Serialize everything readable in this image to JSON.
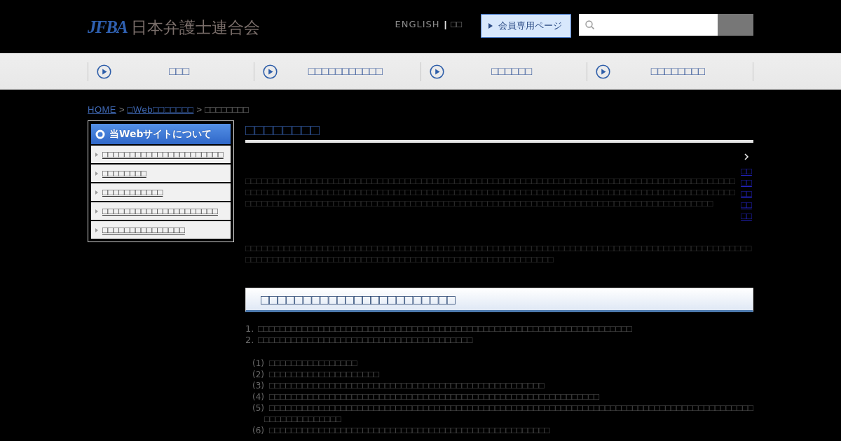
{
  "header": {
    "logo_mark": "JFBA",
    "logo_text": "日本弁護士連合会",
    "language_links": [
      {
        "label": "ENGLISH"
      },
      {
        "label": "□□"
      }
    ],
    "separator": "|",
    "member_button": {
      "label": "会員専用ページ"
    }
  },
  "nav": [
    {
      "label": "□□□"
    },
    {
      "label": "□□□□□□□□□□□"
    },
    {
      "label": "□□□□□□"
    },
    {
      "label": "□□□□□□□□"
    }
  ],
  "breadcrumb": [
    {
      "label": "HOME",
      "kind": "link"
    },
    {
      "label": "□Web□□□□□□□",
      "kind": "link",
      "separator": ">"
    },
    {
      "label": "□□□□□□□□",
      "kind": "current",
      "separator": ">"
    }
  ],
  "sidebar": {
    "title": "当Webサイトについて",
    "items": [
      {
        "label": "□□□□□□□□□□□□□□□□□□□□□□"
      },
      {
        "label": "□□□□□□□□"
      },
      {
        "label": "□□□□□□□□□□□"
      },
      {
        "label": "□□□□□□□□□□□□□□□□□□□□□"
      },
      {
        "label": "□□□□□□□□□□□□□□□"
      }
    ]
  },
  "content": {
    "title": "□□□□□□□□",
    "print_link": "□□□□□□□□□□",
    "paragraphs": [
      "□□□□□□□□□□□□□□□□□□□□□□□□□□□□□□□□□□□□□□□□□□□□□□□□□□□□□□□□□□□□□□□□□□□□□□□□□□□□□□□□□□□□□□□□□□□□□□□□□□□□□□□□□□□□□□□□□□□□□□□□□□□□□□□□□□□□□□□□□□□□□□□□□□□□□□□□□□□□□□□□□□□□□□□□□□□□□□□□□□□□□□□□□□□□□□□□□□□□□□□□□□□□□□□□□□□□□□□□□□□□□□□□□□□□□□□□□□□□□□□□□□□□□□□□□□□□□□□□□□□□□□□",
      "□□□□□□□□□□□□□□□□□□□□□□□□□□□□□□□□□□□□□□□□□□□□□□□□□□□□□□□□□□□□□□□□□□□□□□□□□□□□□□□□□□□□□□□□□□□□□□□□□□□□□□□□□□□□□□□□□□□□□□□□□□□□□□□□□□□□□□□□□□□□□□□□□□□□"
    ],
    "section": {
      "title": "□□□□□□□□□□□□□□□□□□□□□□□",
      "items": [
        {
          "marker": "1.",
          "text": "□□□□□□□□□□□□□□□□□□□□□□□□□□□□□□□□□□□□□□□□□□□□□□□□□□□□□□□□□□□□□□□□□□□□"
        },
        {
          "marker": "2.",
          "text": "□□□□□□□□□□□□□□□□□□□□□□□□□□□□□□□□□□□□□□□"
        }
      ],
      "subitems": [
        {
          "marker": "(1)",
          "text": "□□□□□□□□□□□□□□□□"
        },
        {
          "marker": "(2)",
          "text": "□□□□□□□□□□□□□□□□□□□□"
        },
        {
          "marker": "(3)",
          "text": "□□□□□□□□□□□□□□□□□□□□□□□□□□□□□□□□□□□□□□□□□□□□□□□□□□"
        },
        {
          "marker": "(4)",
          "text": "□□□□□□□□□□□□□□□□□□□□□□□□□□□□□□□□□□□□□□□□□□□□□□□□□□□□□□□□□□□□"
        },
        {
          "marker": "(5)",
          "text": "□□□□□□□□□□□□□□□□□□□□□□□□□□□□□□□□□□□□□□□□□□□□□□□□□□□□□□□□□□□□□□□□□□□□□□□□□□□□□□□□□□□□□□□□□□□□□□□□□□□□□□"
        },
        {
          "marker": "(6)",
          "text": "□□□□□□□□□□□□□□□□□□□□□□□□□□□□□□□□□□□□□□□□□□□□□□□□□□□"
        }
      ]
    }
  }
}
